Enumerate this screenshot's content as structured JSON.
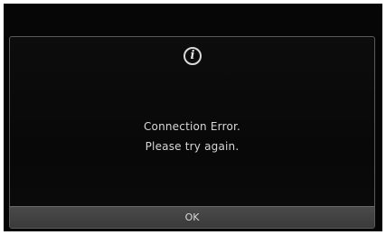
{
  "dialog": {
    "icon": "info-icon",
    "icon_glyph": "i",
    "message_line1": "Connection Error.",
    "message_line2": "Please try again.",
    "ok_label": "OK"
  },
  "colors": {
    "screen_background": "#050505",
    "dialog_border": "#5a5a5a",
    "text": "#d7d7d7",
    "button_background": "#424242"
  }
}
